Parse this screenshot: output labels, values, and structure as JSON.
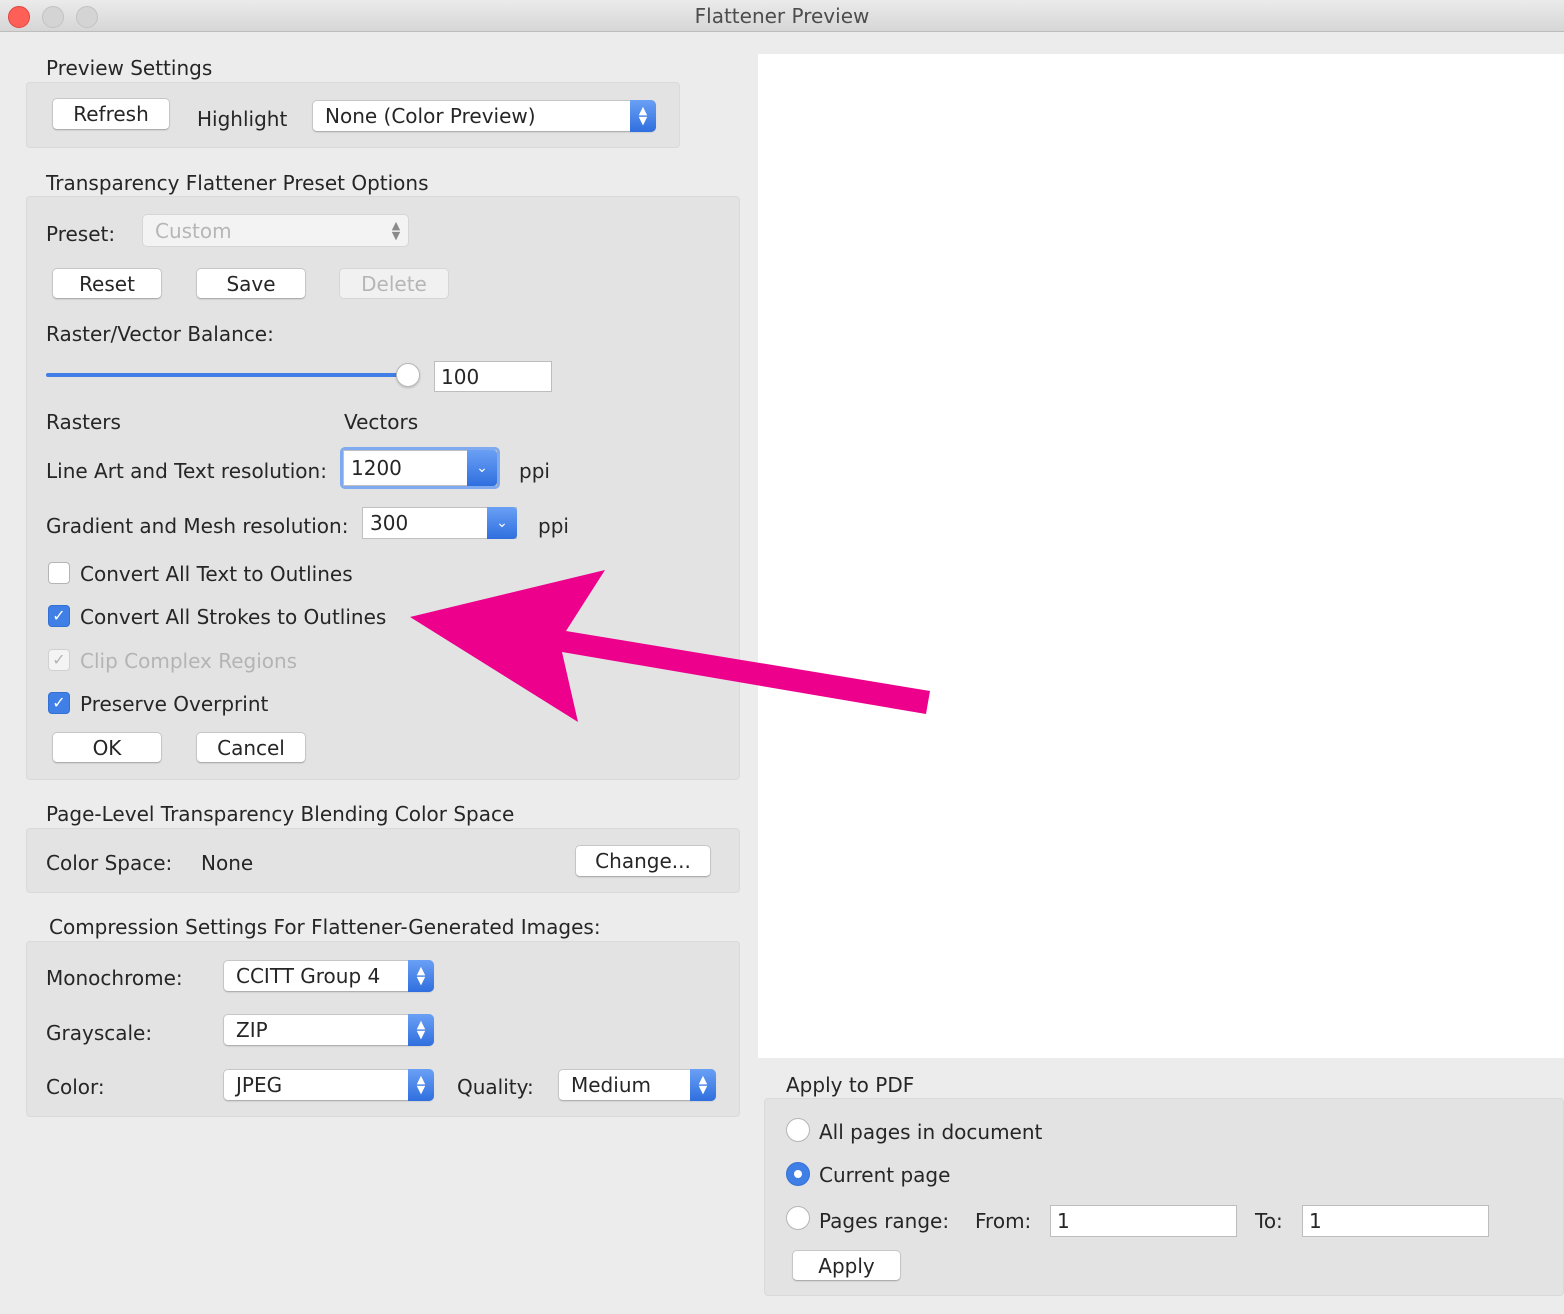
{
  "window": {
    "title": "Flattener Preview"
  },
  "preview_settings": {
    "heading": "Preview Settings",
    "refresh_label": "Refresh",
    "highlight_label": "Highlight",
    "highlight_value": "None (Color Preview)"
  },
  "preset_options": {
    "heading": "Transparency Flattener Preset Options",
    "preset_label": "Preset:",
    "preset_value": "Custom",
    "reset_label": "Reset",
    "save_label": "Save",
    "delete_label": "Delete",
    "balance_label": "Raster/Vector Balance:",
    "balance_value": "100",
    "balance_level": 100,
    "rasters_label": "Rasters",
    "vectors_label": "Vectors",
    "line_art_label": "Line Art and Text resolution:",
    "line_art_value": "1200",
    "line_art_unit": "ppi",
    "gradient_label": "Gradient and Mesh resolution:",
    "gradient_value": "300",
    "gradient_unit": "ppi",
    "checkboxes": [
      {
        "label": "Convert All Text to Outlines",
        "checked": false,
        "disabled": false
      },
      {
        "label": "Convert All Strokes to Outlines",
        "checked": true,
        "disabled": false
      },
      {
        "label": "Clip Complex Regions",
        "checked": true,
        "disabled": true
      },
      {
        "label": "Preserve Overprint",
        "checked": true,
        "disabled": false
      }
    ],
    "ok_label": "OK",
    "cancel_label": "Cancel"
  },
  "color_space": {
    "heading": "Page-Level Transparency Blending Color Space",
    "label": "Color Space:",
    "value": "None",
    "change_label": "Change..."
  },
  "compression": {
    "heading": "Compression Settings For Flattener-Generated Images:",
    "monochrome_label": "Monochrome:",
    "monochrome_value": "CCITT Group 4",
    "grayscale_label": "Grayscale:",
    "grayscale_value": "ZIP",
    "color_label": "Color:",
    "color_value": "JPEG",
    "quality_label": "Quality:",
    "quality_value": "Medium"
  },
  "apply_pdf": {
    "heading": "Apply to PDF",
    "options": [
      {
        "label": "All pages in document",
        "selected": false
      },
      {
        "label": "Current page",
        "selected": true
      },
      {
        "label": "Pages range:",
        "selected": false
      }
    ],
    "from_label": "From:",
    "from_value": "1",
    "to_label": "To:",
    "to_value": "1",
    "apply_label": "Apply"
  },
  "annotation": {
    "arrow_color": "#ec008c"
  },
  "colors": {
    "accent": "#3f7fe6",
    "window_bg": "#ececec",
    "group_bg": "#e3e3e3"
  }
}
